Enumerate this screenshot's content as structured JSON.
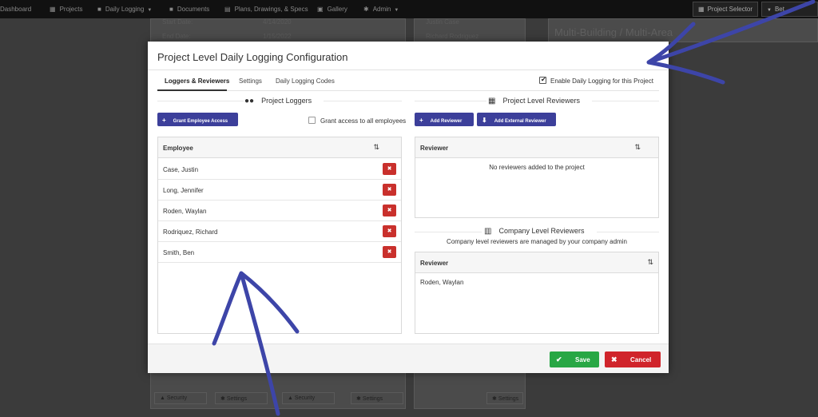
{
  "topnav": {
    "items": [
      {
        "label": "Dashboard",
        "icon": "dashboard-icon",
        "dropdown": false
      },
      {
        "label": "Projects",
        "icon": "building-icon",
        "dropdown": false
      },
      {
        "label": "Daily Logging",
        "icon": "truck-icon",
        "dropdown": true
      },
      {
        "label": "Documents",
        "icon": "folder-icon",
        "dropdown": false
      },
      {
        "label": "Plans, Drawings, & Specs",
        "icon": "file-icon",
        "dropdown": false
      },
      {
        "label": "Gallery",
        "icon": "image-icon",
        "dropdown": false
      },
      {
        "label": "Admin",
        "icon": "gear-icon",
        "dropdown": true
      }
    ],
    "project_selector": "Project Selector",
    "user_menu": "Bet"
  },
  "background": {
    "start_date_label": "Start Date:",
    "start_date_value": "4/14/2020",
    "end_date_label": "End Date:",
    "end_date_value": "1/15/2022",
    "list": [
      "Justin Case",
      "Richard Rodriguez"
    ],
    "heading": "Multi-Building / Multi-Area",
    "security_label": "Security",
    "settings_label": "Settings"
  },
  "modal": {
    "title": "Project Level Daily Logging Configuration",
    "tabs": [
      "Loggers & Reviewers",
      "Settings",
      "Daily Logging Codes"
    ],
    "active_tab": "Loggers & Reviewers",
    "enable_label": "Enable Daily Logging for this Project",
    "enable_checked": true,
    "loggers": {
      "heading": "Project Loggers",
      "grant_button": "Grant Employee Access",
      "grant_all_label": "Grant access to all employees",
      "grant_all_checked": false,
      "column": "Employee",
      "rows": [
        "Case, Justin",
        "Long, Jennifer",
        "Roden, Waylan",
        "Rodriquez, Richard",
        "Smith, Ben"
      ]
    },
    "reviewers": {
      "heading": "Project Level Reviewers",
      "add_button": "Add Reviewer",
      "add_external_button": "Add External Reviewer",
      "column": "Reviewer",
      "empty_text": "No reviewers added to the project"
    },
    "company_reviewers": {
      "heading": "Company Level Reviewers",
      "subtitle": "Company level reviewers are managed by your company admin",
      "column": "Reviewer",
      "rows": [
        "Roden, Waylan"
      ]
    },
    "save_label": "Save",
    "cancel_label": "Cancel"
  },
  "colors": {
    "primary": "#3c3f9a",
    "success": "#28a745",
    "danger": "#d0242b",
    "annotation": "#3d45a8"
  }
}
